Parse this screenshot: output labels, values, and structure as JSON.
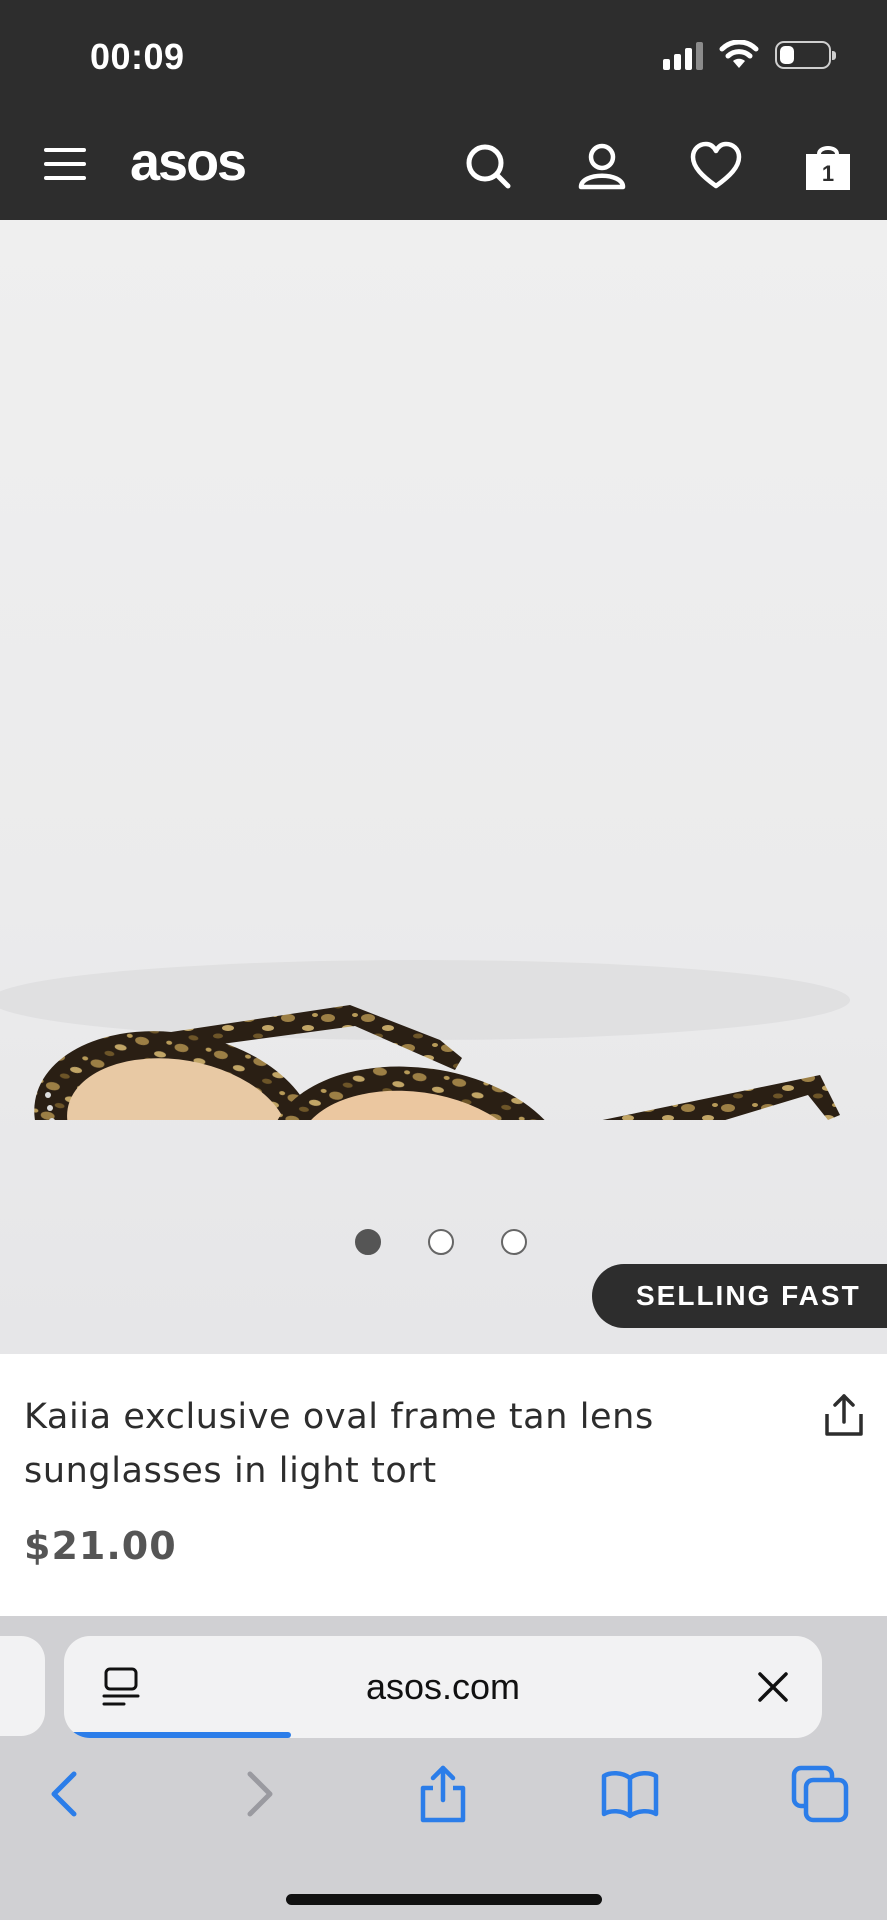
{
  "status_bar": {
    "time": "00:09",
    "battery_level": 0.3
  },
  "header": {
    "logo": "asos",
    "menu_icon": "hamburger-menu-icon",
    "icons": [
      "search-icon",
      "account-icon",
      "heart-icon",
      "bag-icon"
    ],
    "bag_count": "1",
    "background_color": "#2d2d2d"
  },
  "product": {
    "image_dots": {
      "count": 3,
      "active_index": 0
    },
    "badge": "SELLING FAST",
    "title": "Kaiia exclusive oval frame tan lens sunglasses in light tort",
    "price": "$21.00"
  },
  "browser": {
    "url": "asos.com",
    "load_progress": 0.3,
    "accent_color": "#2b7de9",
    "toolbar": [
      "back-icon",
      "forward-icon",
      "share-icon",
      "bookmarks-icon",
      "tabs-icon"
    ]
  }
}
